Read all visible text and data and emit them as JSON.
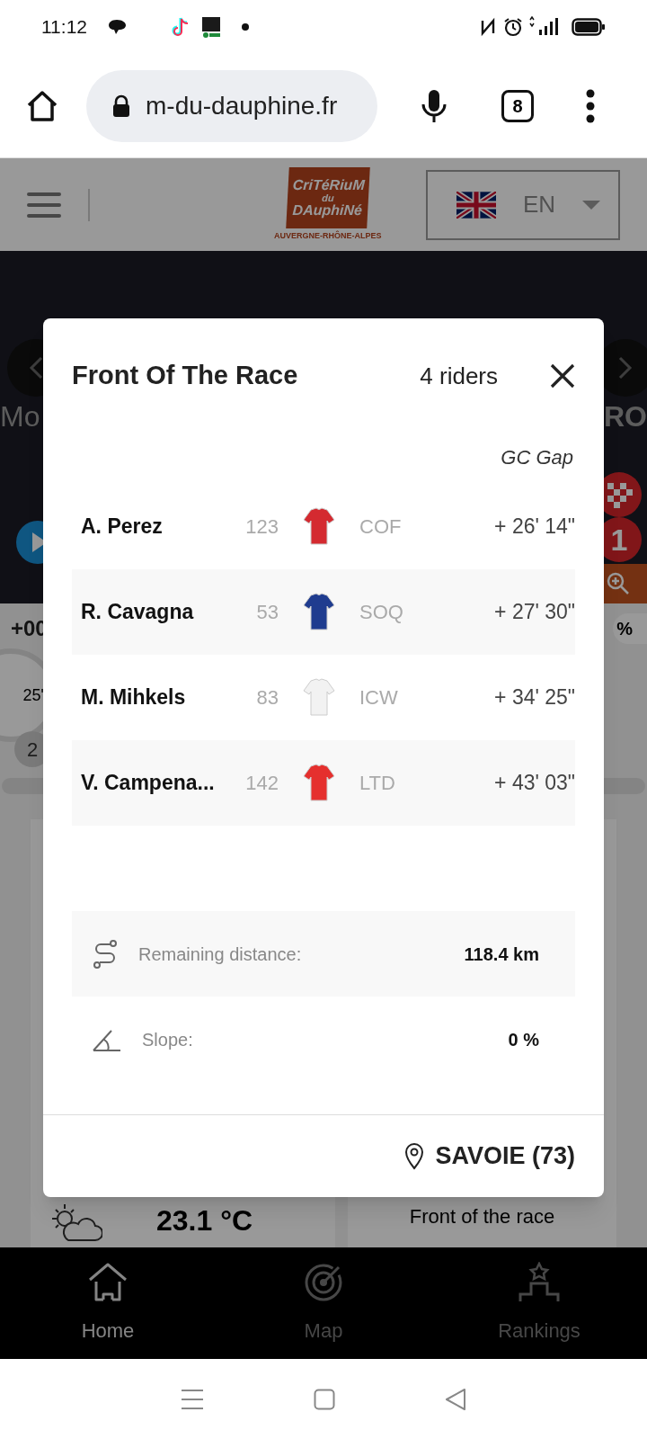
{
  "status_bar": {
    "time": "11:12"
  },
  "browser": {
    "url": "m-du-dauphine.fr",
    "tab_count": "8"
  },
  "site_header": {
    "logo_lines": [
      "CriTéRiuM",
      "du",
      "DAuphiNé"
    ],
    "logo_subtitle": "AUVERGNE-RHÔNE-ALPES",
    "language": "EN"
  },
  "background": {
    "left_label": "Mo",
    "right_label": "RO",
    "badge_number": "1",
    "left_value": "+00",
    "right_value": "%",
    "gauge_text": "25\"",
    "pill_text": "2",
    "temperature": "23.1 °C",
    "card_label": "Front of the race"
  },
  "modal": {
    "title": "Front Of The Race",
    "count": "4 riders",
    "column_header": "GC Gap",
    "riders": [
      {
        "name": "A. Perez",
        "number": "123",
        "team": "COF",
        "gap": "+ 26' 14\"",
        "color": "#d42a30"
      },
      {
        "name": "R. Cavagna",
        "number": "53",
        "team": "SOQ",
        "gap": "+ 27' 30\"",
        "color": "#1f3c8f"
      },
      {
        "name": "M. Mihkels",
        "number": "83",
        "team": "ICW",
        "gap": "+ 34' 25\"",
        "color": "#f2f2f2"
      },
      {
        "name": "V. Campena...",
        "number": "142",
        "team": "LTD",
        "gap": "+ 43' 03\"",
        "color": "#e5302e"
      }
    ],
    "stats": [
      {
        "label": "Remaining distance:",
        "value": "118.4 km"
      },
      {
        "label": "Slope:",
        "value": "0 %"
      }
    ],
    "location": "SAVOIE (73)"
  },
  "bottom_nav": [
    {
      "label": "Home",
      "selected": true
    },
    {
      "label": "Map",
      "selected": false
    },
    {
      "label": "Rankings",
      "selected": false
    }
  ]
}
